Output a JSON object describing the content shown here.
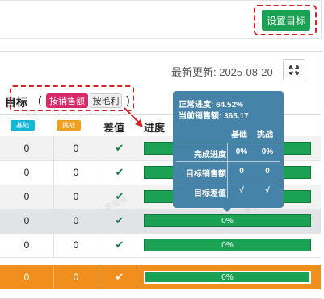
{
  "toolbar": {
    "set_target_label": "设置目标"
  },
  "card": {
    "last_update": "最新更新: 2025-08-20"
  },
  "target_section": {
    "label": "目标",
    "paren_open": "(",
    "paren_close": ")",
    "toggle_sales": "按销售额",
    "toggle_margin": "按毛利"
  },
  "table": {
    "badge_base": "基础",
    "badge_challenge": "挑战",
    "col_diff": "差值",
    "col_progress": "进度",
    "rows": [
      {
        "base": "0",
        "challenge": "0",
        "diff": "✔",
        "progress": ""
      },
      {
        "base": "0",
        "challenge": "0",
        "diff": "✔",
        "progress": ""
      },
      {
        "base": "0",
        "challenge": "0",
        "diff": "✔",
        "progress": ""
      },
      {
        "base": "0",
        "challenge": "0",
        "diff": "✔",
        "progress": "0%"
      },
      {
        "base": "0",
        "challenge": "0",
        "diff": "✔",
        "progress": "0%"
      },
      {
        "base": "0",
        "challenge": "0",
        "diff": "✔",
        "progress": "0%"
      }
    ]
  },
  "tooltip": {
    "normal_progress": "正常进度: 64.52%",
    "current_sales": "当前销售额: 365.17",
    "col_base": "基础",
    "col_challenge": "挑战",
    "rows": [
      {
        "label": "完成进度",
        "base": "0%",
        "challenge": "0%"
      },
      {
        "label": "目标销售额",
        "base": "0",
        "challenge": "0"
      },
      {
        "label": "目标差值",
        "base": "√",
        "challenge": "√"
      }
    ]
  },
  "watermark_text": "李雪倩",
  "colors": {
    "green": "#1aa154",
    "pink": "#d8286a",
    "orange": "#f18f1e",
    "tooltip": "#4683a8"
  }
}
